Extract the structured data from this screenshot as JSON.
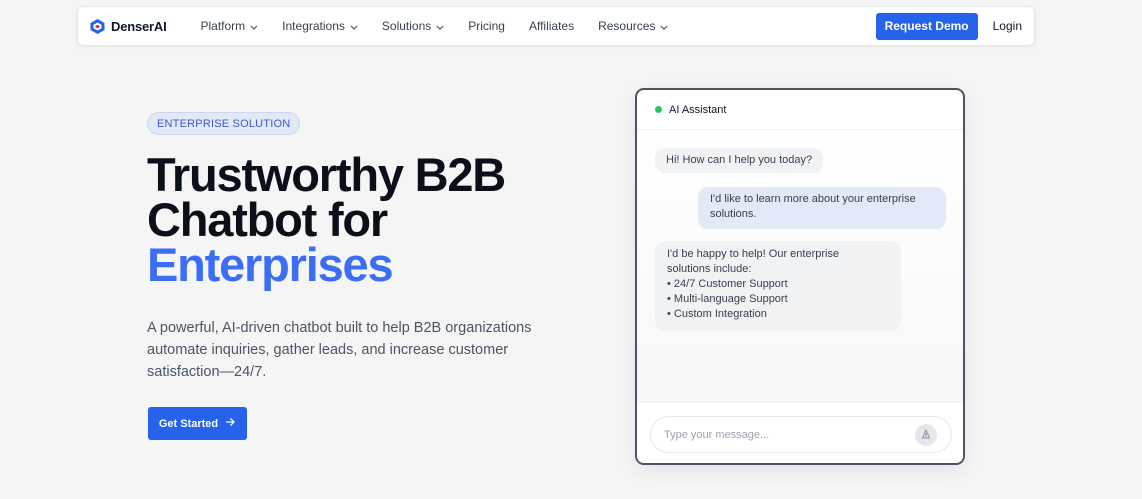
{
  "nav": {
    "brand": "DenserAI",
    "links": [
      {
        "label": "Platform",
        "dropdown": true
      },
      {
        "label": "Integrations",
        "dropdown": true
      },
      {
        "label": "Solutions",
        "dropdown": true
      },
      {
        "label": "Pricing",
        "dropdown": false
      },
      {
        "label": "Affiliates",
        "dropdown": false
      },
      {
        "label": "Resources",
        "dropdown": true
      }
    ],
    "request_demo": "Request Demo",
    "login": "Login"
  },
  "hero": {
    "badge": "ENTERPRISE SOLUTION",
    "headline_line1": "Trustworthy B2B",
    "headline_line2": "Chatbot for",
    "headline_accent": "Enterprises",
    "lead": "A powerful, AI-driven chatbot built to help B2B organizations automate inquiries, gather leads, and increase customer satisfaction—24/7.",
    "cta": "Get Started"
  },
  "chat": {
    "title": "AI Assistant",
    "status_color": "#22c55e",
    "messages": [
      {
        "from": "bot",
        "text": "Hi! How can I help you today?"
      },
      {
        "from": "user",
        "text": "I'd like to learn more about your enterprise solutions."
      },
      {
        "from": "bot",
        "lines": [
          "I'd be happy to help! Our enterprise",
          "solutions include:",
          "• 24/7 Customer Support",
          "• Multi-language Support",
          "• Custom Integration"
        ]
      }
    ],
    "input_placeholder": "Type your message..."
  },
  "colors": {
    "accent": "#2563eb",
    "headline_accent": "#3b6ef5",
    "background": "#f5f5f5"
  },
  "icons": {
    "logo": "denserai-logo-icon",
    "dropdown": "chevron-down-icon",
    "cta": "arrow-right-icon",
    "send": "send-icon"
  }
}
